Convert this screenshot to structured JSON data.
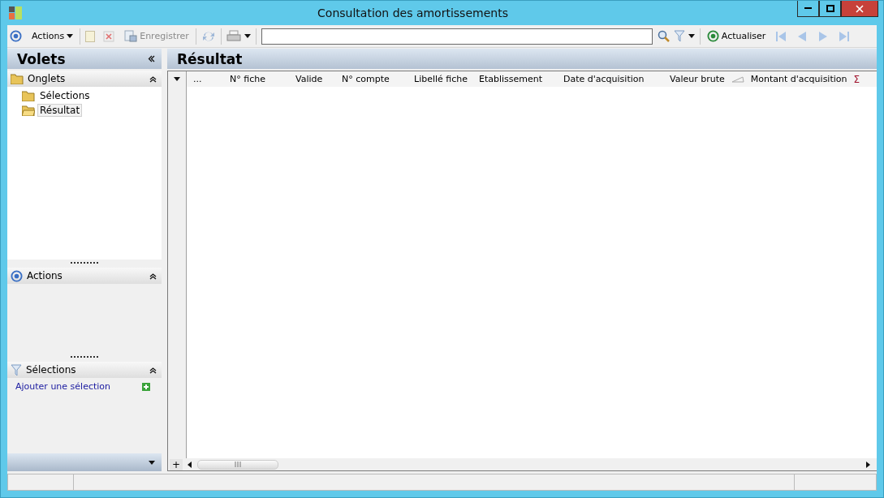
{
  "window": {
    "title": "Consultation des amortissements"
  },
  "toolbar": {
    "actions_label": "Actions",
    "save": {
      "label": "Enregistrer",
      "disabled": true
    },
    "refresh_label": "Actualiser",
    "nav_disabled": true
  },
  "sidebar": {
    "title": "Volets",
    "sections": [
      {
        "kind": "tree",
        "title": "Onglets",
        "expanded": true,
        "items": [
          {
            "label": "Sélections",
            "selected": false
          },
          {
            "label": "Résultat",
            "selected": true
          }
        ]
      },
      {
        "kind": "actions",
        "title": "Actions",
        "expanded": true
      },
      {
        "kind": "filter",
        "title": "Sélections",
        "expanded": true,
        "link": "Ajouter une sélection"
      }
    ]
  },
  "result": {
    "title": "Résultat",
    "columns": [
      {
        "label": "...",
        "sorted": false
      },
      {
        "label": "N° fiche",
        "sorted": false
      },
      {
        "label": "Valide",
        "sorted": false
      },
      {
        "label": "N° compte",
        "sorted": false
      },
      {
        "label": "Libellé fiche",
        "sorted": false
      },
      {
        "label": "Etablissement",
        "sorted": false
      },
      {
        "label": "Date d'acquisition",
        "sorted": false
      },
      {
        "label": "Valeur brute",
        "sorted": true
      },
      {
        "label": "Montant d'acquisition",
        "sorted": false,
        "sum_sign": "Σ"
      }
    ],
    "add_row": "+"
  }
}
